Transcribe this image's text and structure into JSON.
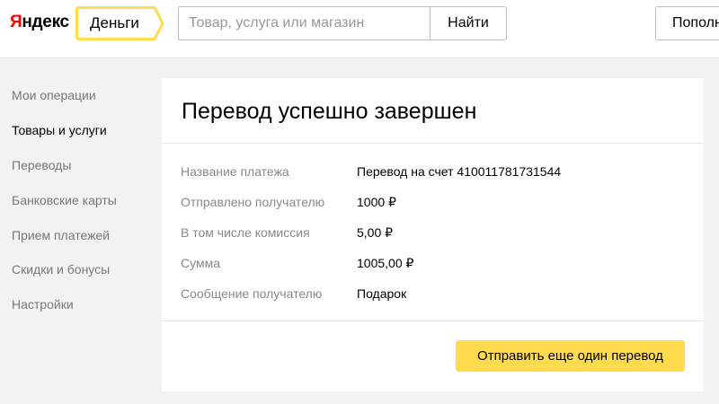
{
  "header": {
    "logo_first": "Я",
    "logo_rest": "ндекс",
    "service_label": "Деньги",
    "search": {
      "placeholder": "Товар, услуга или магазин",
      "value": ""
    },
    "search_button": "Найти",
    "topup_button": "Пополнить"
  },
  "sidebar": {
    "items": [
      {
        "label": "Мои операции",
        "active": false
      },
      {
        "label": "Товары и услуги",
        "active": true
      },
      {
        "label": "Переводы",
        "active": false
      },
      {
        "label": "Банковские карты",
        "active": false
      },
      {
        "label": "Прием платежей",
        "active": false
      },
      {
        "label": "Скидки и бонусы",
        "active": false
      },
      {
        "label": "Настройки",
        "active": false
      }
    ]
  },
  "card": {
    "title": "Перевод успешно завершен",
    "rows": [
      {
        "label": "Название платежа",
        "value": "Перевод на счет 410011781731544"
      },
      {
        "label": "Отправлено получателю",
        "value": "1000 ₽"
      },
      {
        "label": "В том числе комиссия",
        "value": "5,00 ₽"
      },
      {
        "label": "Сумма",
        "value": "1005,00 ₽"
      },
      {
        "label": "Сообщение получателю",
        "value": "Подарок"
      }
    ],
    "send_again_button": "Отправить еще один перевод"
  },
  "colors": {
    "accent_yellow": "#ffdb4d",
    "logo_red": "#ff0000",
    "page_background": "#f2f2f2"
  }
}
